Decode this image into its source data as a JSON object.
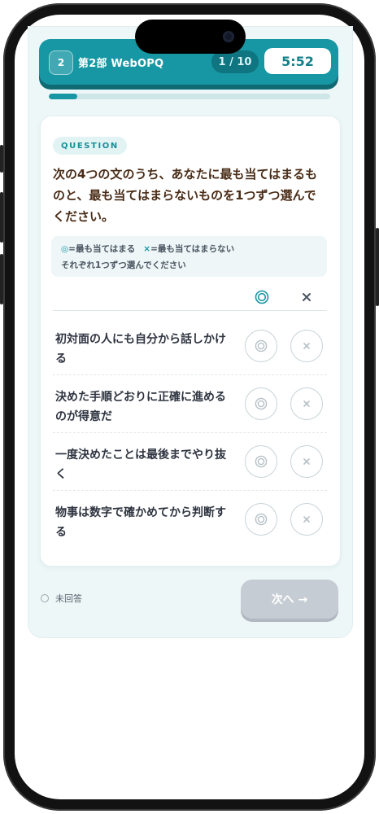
{
  "header": {
    "section_number": "2",
    "section_title": "第2部 WebOPQ",
    "counter": "1 / 10",
    "timer": "5:52",
    "progress_fraction": 0.1
  },
  "question": {
    "tag": "QUESTION",
    "text": "次の4つの文のうち、あなたに最も当てはまるものと、最も当てはまらないものを1つずつ選んでください。"
  },
  "legend": {
    "best_symbol": "◎",
    "best_text": "=最も当てはまる",
    "worst_symbol": "×",
    "worst_text": "=最も当てはまらない",
    "instruction": "それぞれ1つずつ選んでください"
  },
  "columns": {
    "best_icon": "double-circle-icon",
    "worst_icon": "cross-icon"
  },
  "statements": [
    {
      "text": "初対面の人にも自分から話しかける"
    },
    {
      "text": "決めた手順どおりに正確に進めるのが得意だ"
    },
    {
      "text": "一度決めたことは最後までやり抜く"
    },
    {
      "text": "物事は数字で確かめてから判断する"
    }
  ],
  "footer": {
    "status_text": "未回答",
    "next_label": "次へ →"
  },
  "colors": {
    "accent": "#1797a3",
    "accent_dark": "#0f6a74",
    "question_text": "#4a2c17",
    "disabled_button": "#c6ccd4"
  }
}
